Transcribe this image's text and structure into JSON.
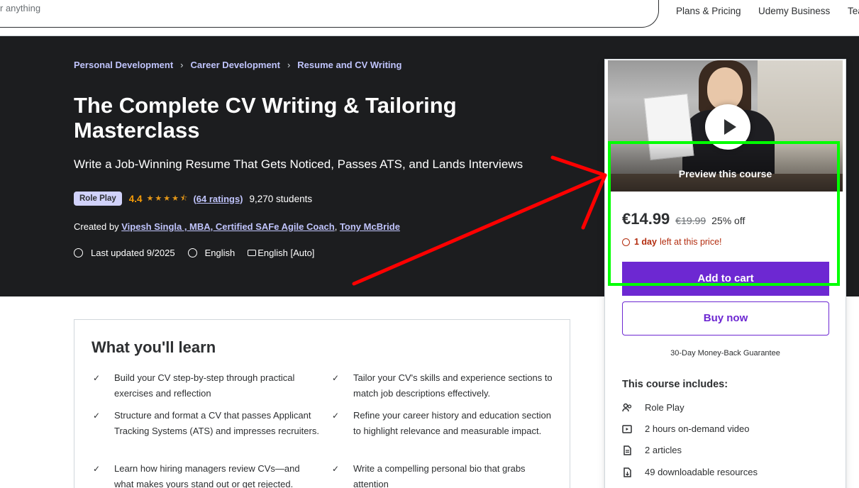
{
  "topbar": {
    "search_placeholder": "r anything",
    "links": [
      "Plans & Pricing",
      "Udemy Business",
      "Tea"
    ]
  },
  "breadcrumb": [
    "Personal Development",
    "Career Development",
    "Resume and CV Writing"
  ],
  "course": {
    "title": "The Complete CV Writing & Tailoring Masterclass",
    "subtitle": "Write a Job-Winning Resume That Gets Noticed, Passes ATS, and Lands Interviews",
    "badge": "Role Play",
    "rating": "4.4",
    "stars": "★★★★⯪",
    "ratings_count": "(64 ratings)",
    "students": "9,270 students",
    "created_by_label": "Created by",
    "instructors": [
      "Vipesh Singla , MBA, Certified SAFe Agile Coach",
      "Tony McBride"
    ],
    "last_updated": "Last updated 9/2025",
    "language": "English",
    "captions": "English [Auto]"
  },
  "sidebar": {
    "preview_label": "Preview this course",
    "price": "€14.99",
    "old_price": "€19.99",
    "discount": "25% off",
    "timer_bold": "1 day",
    "timer_rest": "left at this price!",
    "add_to_cart": "Add to cart",
    "buy_now": "Buy now",
    "guarantee": "30-Day Money-Back Guarantee",
    "includes_title": "This course includes:",
    "includes": [
      {
        "icon": "role-play-icon",
        "label": "Role Play"
      },
      {
        "icon": "video-icon",
        "label": "2 hours on-demand video"
      },
      {
        "icon": "article-icon",
        "label": "2 articles"
      },
      {
        "icon": "download-icon",
        "label": "49 downloadable resources"
      }
    ]
  },
  "learn": {
    "title": "What you'll learn",
    "items": [
      "Build your CV step-by-step through practical exercises and reflection",
      "Tailor your CV's skills and experience sections to match job descriptions effectively.",
      "Structure and format a CV that passes Applicant Tracking Systems (ATS) and impresses recruiters.",
      "Refine your career history and education section to highlight relevance and measurable impact.",
      "Learn how hiring managers review CVs—and what makes yours stand out or get rejected.",
      "Write a compelling personal bio that grabs attention"
    ]
  },
  "colors": {
    "hero_bg": "#1c1d1f",
    "accent": "#6d28d2",
    "link": "#c0c4fc",
    "rating": "#f69c08",
    "annotation_box": "#00ff00",
    "annotation_arrow": "#ff0000"
  }
}
